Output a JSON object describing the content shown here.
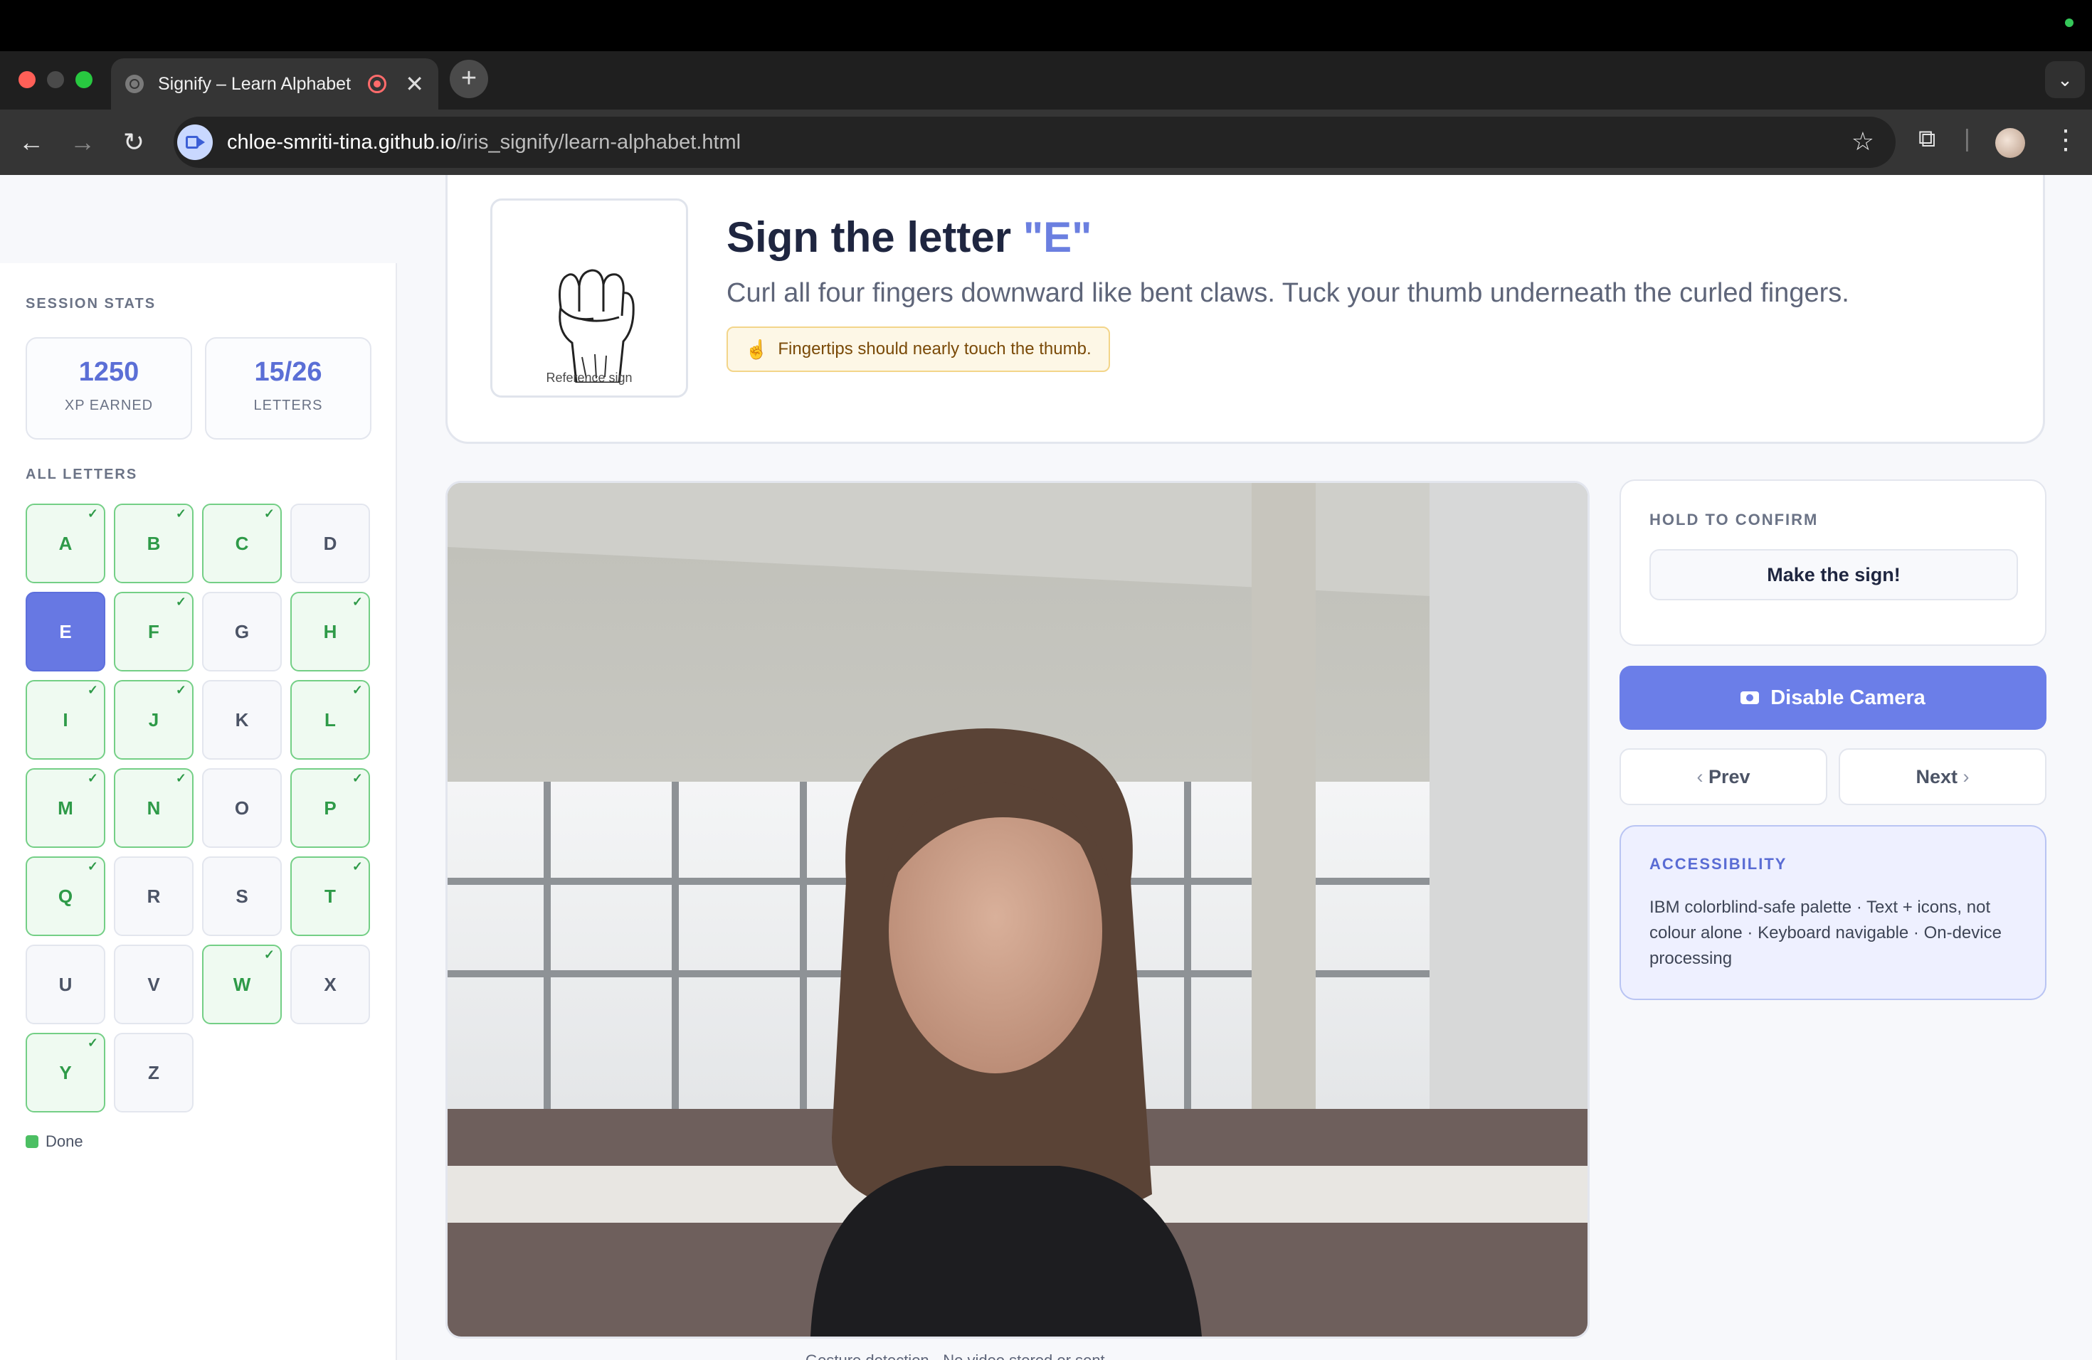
{
  "browser": {
    "tab_title": "Signify – Learn Alphabet",
    "url_host": "chloe-smriti-tina.github.io",
    "url_path": "/iris_signify/learn-alphabet.html",
    "new_tab": "+",
    "tab_close": "✕"
  },
  "sidebar": {
    "stats_label": "SESSION STATS",
    "xp_value": "1250",
    "xp_label": "XP EARNED",
    "letters_value": "15/26",
    "letters_label": "LETTERS",
    "all_letters_label": "ALL LETTERS",
    "letters": [
      {
        "l": "A",
        "s": "done"
      },
      {
        "l": "B",
        "s": "done"
      },
      {
        "l": "C",
        "s": "done"
      },
      {
        "l": "D",
        "s": "todo"
      },
      {
        "l": "E",
        "s": "active"
      },
      {
        "l": "F",
        "s": "done"
      },
      {
        "l": "G",
        "s": "todo"
      },
      {
        "l": "H",
        "s": "done"
      },
      {
        "l": "I",
        "s": "done"
      },
      {
        "l": "J",
        "s": "done"
      },
      {
        "l": "K",
        "s": "todo"
      },
      {
        "l": "L",
        "s": "done"
      },
      {
        "l": "M",
        "s": "done"
      },
      {
        "l": "N",
        "s": "done"
      },
      {
        "l": "O",
        "s": "todo"
      },
      {
        "l": "P",
        "s": "done"
      },
      {
        "l": "Q",
        "s": "done"
      },
      {
        "l": "R",
        "s": "todo"
      },
      {
        "l": "S",
        "s": "todo"
      },
      {
        "l": "T",
        "s": "done"
      },
      {
        "l": "U",
        "s": "todo"
      },
      {
        "l": "V",
        "s": "todo"
      },
      {
        "l": "W",
        "s": "done"
      },
      {
        "l": "X",
        "s": "todo"
      },
      {
        "l": "Y",
        "s": "done"
      },
      {
        "l": "Z",
        "s": "todo"
      }
    ],
    "legend_done": "Done"
  },
  "lesson": {
    "reference_caption": "Reference sign",
    "title_prefix": "Sign the letter ",
    "title_letter": "\"E\"",
    "description": "Curl all four fingers downward like bent claws. Tuck your thumb underneath the curled fingers.",
    "tip": "Fingertips should nearly touch the thumb."
  },
  "panel": {
    "hold_label": "HOLD TO CONFIRM",
    "hold_button": "Make the sign!",
    "camera_button": "Disable Camera",
    "prev": "Prev",
    "next": "Next",
    "a11y_label": "ACCESSIBILITY",
    "a11y_text": "IBM colorblind-safe palette · Text + icons, not colour alone · Keyboard navigable · On-device processing"
  },
  "footer_note": "Gesture detection · No video stored or sent",
  "colors": {
    "accent": "#6b7ee8",
    "done": "#4cbf63",
    "tip_bg": "#fdf7e6"
  }
}
